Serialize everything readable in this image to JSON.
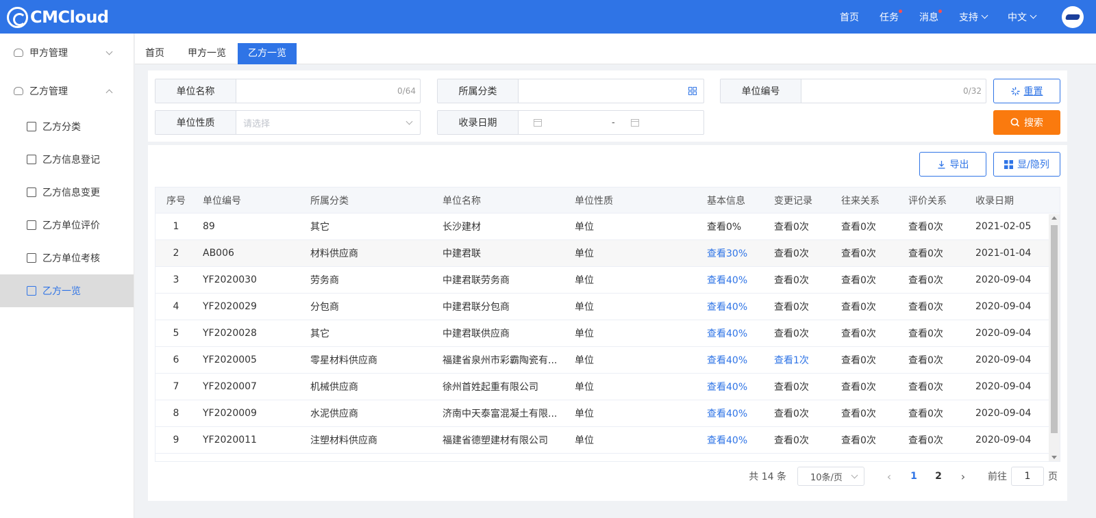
{
  "brand": {
    "name": "CMCloud"
  },
  "topnav": {
    "home": "首页",
    "tasks": "任务",
    "messages": "消息",
    "support": "支持",
    "language": "中文"
  },
  "sidebar": {
    "groups": [
      {
        "label": "甲方管理",
        "expanded": false
      },
      {
        "label": "乙方管理",
        "expanded": true
      }
    ],
    "items": [
      {
        "label": "乙方分类"
      },
      {
        "label": "乙方信息登记"
      },
      {
        "label": "乙方信息变更"
      },
      {
        "label": "乙方单位评价"
      },
      {
        "label": "乙方单位考核"
      },
      {
        "label": "乙方一览",
        "active": true
      }
    ]
  },
  "tabs": [
    {
      "label": "首页"
    },
    {
      "label": "甲方一览"
    },
    {
      "label": "乙方一览",
      "active": true
    }
  ],
  "filter": {
    "unit_name": {
      "label": "单位名称",
      "counter": "0/64"
    },
    "category": {
      "label": "所属分类"
    },
    "unit_code": {
      "label": "单位编号",
      "counter": "0/32"
    },
    "unit_nature": {
      "label": "单位性质",
      "placeholder": "请选择"
    },
    "record_date": {
      "label": "收录日期",
      "separator": "-"
    },
    "reset_label": "重置",
    "search_label": "搜索"
  },
  "toolbar": {
    "export_label": "导出",
    "columns_label": "显/隐列"
  },
  "table": {
    "headers": [
      "序号",
      "单位编号",
      "所属分类",
      "单位名称",
      "单位性质",
      "基本信息",
      "变更记录",
      "往来关系",
      "评价关系",
      "收录日期"
    ],
    "rows": [
      {
        "no": "1",
        "code": "89",
        "category": "其它",
        "name": "长沙建材",
        "nature": "单位",
        "basic": "查看0%",
        "basic_link": false,
        "change": "查看0次",
        "change_link": false,
        "contact": "查看0次",
        "eval": "查看0次",
        "date": "2021-02-05"
      },
      {
        "no": "2",
        "code": "AB006",
        "category": "材料供应商",
        "name": "中建君联",
        "nature": "单位",
        "basic": "查看30%",
        "basic_link": true,
        "change": "查看0次",
        "change_link": false,
        "contact": "查看0次",
        "eval": "查看0次",
        "date": "2021-01-04"
      },
      {
        "no": "3",
        "code": "YF2020030",
        "category": "劳务商",
        "name": "中建君联劳务商",
        "nature": "单位",
        "basic": "查看40%",
        "basic_link": true,
        "change": "查看0次",
        "change_link": false,
        "contact": "查看0次",
        "eval": "查看0次",
        "date": "2020-09-04"
      },
      {
        "no": "4",
        "code": "YF2020029",
        "category": "分包商",
        "name": "中建君联分包商",
        "nature": "单位",
        "basic": "查看40%",
        "basic_link": true,
        "change": "查看0次",
        "change_link": false,
        "contact": "查看0次",
        "eval": "查看0次",
        "date": "2020-09-04"
      },
      {
        "no": "5",
        "code": "YF2020028",
        "category": "其它",
        "name": "中建君联供应商",
        "nature": "单位",
        "basic": "查看40%",
        "basic_link": true,
        "change": "查看0次",
        "change_link": false,
        "contact": "查看0次",
        "eval": "查看0次",
        "date": "2020-09-04"
      },
      {
        "no": "6",
        "code": "YF2020005",
        "category": "零星材料供应商",
        "name": "福建省泉州市彩霸陶瓷有...",
        "nature": "单位",
        "basic": "查看40%",
        "basic_link": true,
        "change": "查看1次",
        "change_link": true,
        "contact": "查看0次",
        "eval": "查看0次",
        "date": "2020-09-04"
      },
      {
        "no": "7",
        "code": "YF2020007",
        "category": "机械供应商",
        "name": "徐州首姓起重有限公司",
        "nature": "单位",
        "basic": "查看40%",
        "basic_link": true,
        "change": "查看0次",
        "change_link": false,
        "contact": "查看0次",
        "eval": "查看0次",
        "date": "2020-09-04"
      },
      {
        "no": "8",
        "code": "YF2020009",
        "category": "水泥供应商",
        "name": "济南中天泰富混凝土有限...",
        "nature": "单位",
        "basic": "查看40%",
        "basic_link": true,
        "change": "查看0次",
        "change_link": false,
        "contact": "查看0次",
        "eval": "查看0次",
        "date": "2020-09-04"
      },
      {
        "no": "9",
        "code": "YF2020011",
        "category": "注塑材料供应商",
        "name": "福建省德塑建材有限公司",
        "nature": "单位",
        "basic": "查看40%",
        "basic_link": true,
        "change": "查看0次",
        "change_link": false,
        "contact": "查看0次",
        "eval": "查看0次",
        "date": "2020-09-04"
      }
    ]
  },
  "pagination": {
    "total": "共 14 条",
    "page_size": "10条/页",
    "pages": [
      "1",
      "2"
    ],
    "current": "1",
    "goto_label": "前往",
    "goto_value": "1",
    "page_unit": "页"
  },
  "colors": {
    "primary": "#2f74e6",
    "accent": "#fa7a0e",
    "badge": "#ff4d4f"
  }
}
